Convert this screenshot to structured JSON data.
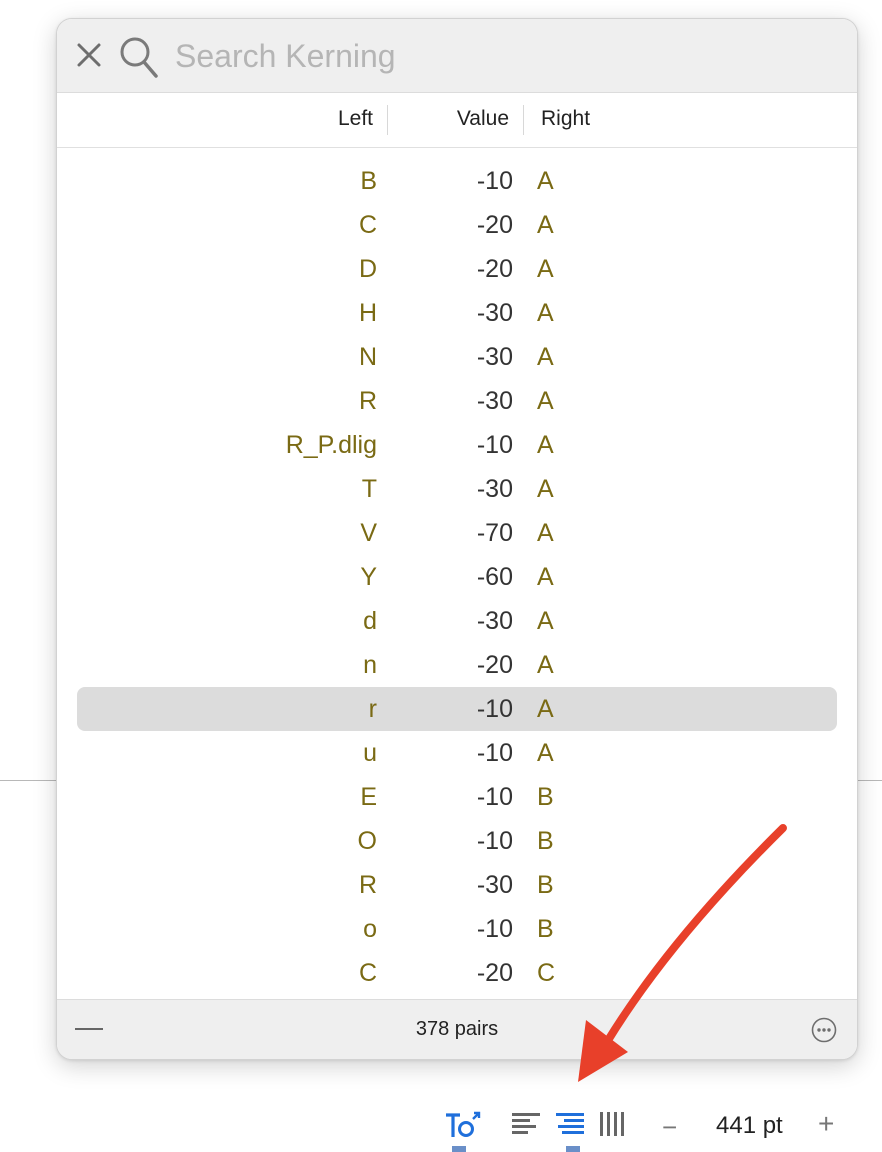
{
  "search": {
    "placeholder": "Search Kerning",
    "value": ""
  },
  "columns": {
    "left": "Left",
    "value": "Value",
    "right": "Right"
  },
  "rows": [
    {
      "left": "B",
      "value": "-10",
      "right": "A",
      "selected": false
    },
    {
      "left": "C",
      "value": "-20",
      "right": "A",
      "selected": false
    },
    {
      "left": "D",
      "value": "-20",
      "right": "A",
      "selected": false
    },
    {
      "left": "H",
      "value": "-30",
      "right": "A",
      "selected": false
    },
    {
      "left": "N",
      "value": "-30",
      "right": "A",
      "selected": false
    },
    {
      "left": "R",
      "value": "-30",
      "right": "A",
      "selected": false
    },
    {
      "left": "R_P.dlig",
      "value": "-10",
      "right": "A",
      "selected": false
    },
    {
      "left": "T",
      "value": "-30",
      "right": "A",
      "selected": false
    },
    {
      "left": "V",
      "value": "-70",
      "right": "A",
      "selected": false
    },
    {
      "left": "Y",
      "value": "-60",
      "right": "A",
      "selected": false
    },
    {
      "left": "d",
      "value": "-30",
      "right": "A",
      "selected": false
    },
    {
      "left": "n",
      "value": "-20",
      "right": "A",
      "selected": false
    },
    {
      "left": "r",
      "value": "-10",
      "right": "A",
      "selected": true
    },
    {
      "left": "u",
      "value": "-10",
      "right": "A",
      "selected": false
    },
    {
      "left": "E",
      "value": "-10",
      "right": "B",
      "selected": false
    },
    {
      "left": "O",
      "value": "-10",
      "right": "B",
      "selected": false
    },
    {
      "left": "R",
      "value": "-30",
      "right": "B",
      "selected": false
    },
    {
      "left": "o",
      "value": "-10",
      "right": "B",
      "selected": false
    },
    {
      "left": "C",
      "value": "-20",
      "right": "C",
      "selected": false
    }
  ],
  "footer": {
    "pairs_count": "378 pairs"
  },
  "toolbar": {
    "icons": [
      "text-transform-icon",
      "align-left-icon",
      "align-right-icon",
      "columns-icon"
    ],
    "zoom_value": "441 pt",
    "zoom_out": "−",
    "zoom_in": "+"
  },
  "colors": {
    "glyph_name": "#7a6a14",
    "accent_blue": "#1f6fdb",
    "annotation_arrow": "#e8402a",
    "selected_row": "#dcdcdc"
  }
}
